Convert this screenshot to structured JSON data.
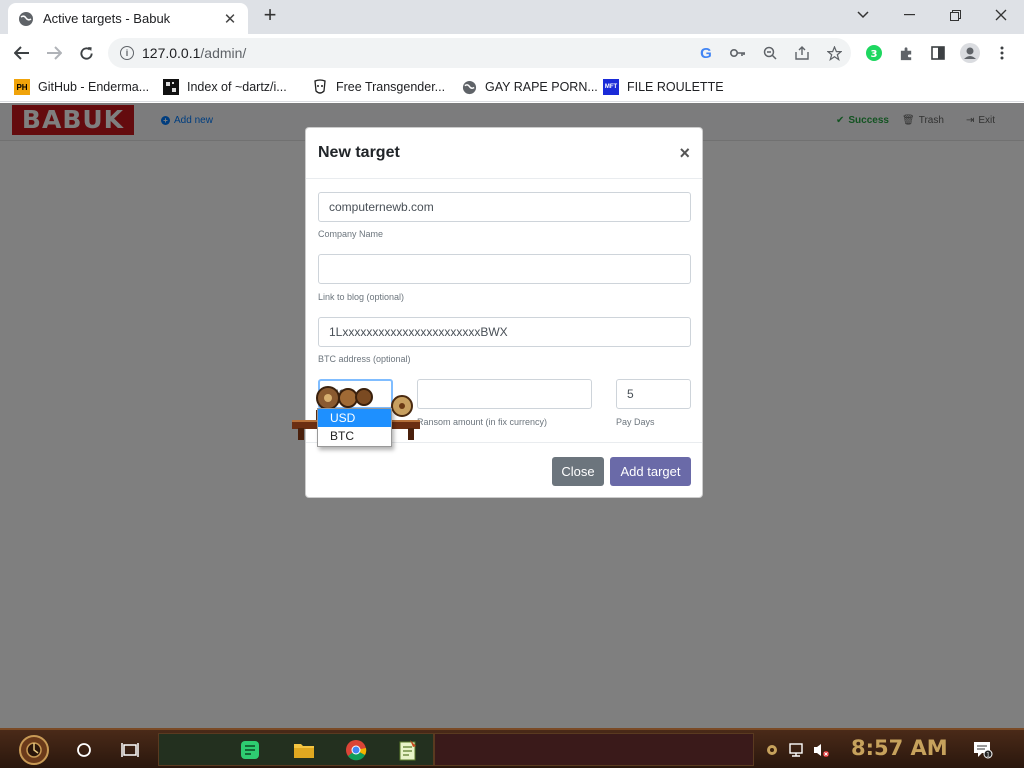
{
  "browser": {
    "tab_title": "Active targets - Babuk",
    "address_host": "127.0.0.1",
    "address_path": "/admin/",
    "bookmarks": [
      {
        "icon": "ph-icon",
        "label": "GitHub - Enderma..."
      },
      {
        "icon": "grid-icon",
        "label": "Index of ~dartz/i..."
      },
      {
        "icon": "face-icon",
        "label": "Free Transgender..."
      },
      {
        "icon": "globe-icon",
        "label": "GAY RAPE PORN..."
      },
      {
        "icon": "mft-icon",
        "label": "FILE ROULETTE"
      }
    ]
  },
  "app": {
    "logo": "BABUK",
    "add_new": "Add new",
    "success": "Success",
    "trash": "Trash",
    "exit": "Exit"
  },
  "modal": {
    "title": "New target",
    "close_x": "×",
    "company_value": "computernewb.com",
    "company_label": "Company Name",
    "blog_value": "",
    "blog_label": "Link to blog (optional)",
    "btc_value": "1LxxxxxxxxxxxxxxxxxxxxxxxBWX",
    "btc_label": "BTC address (optional)",
    "ransom_value": "",
    "ransom_label": "Ransom amount (in fix currency)",
    "paydays_value": "5",
    "paydays_label": "Pay Days",
    "currency_options": [
      "USD",
      "BTC"
    ],
    "currency_selected": "USD",
    "close_button": "Close",
    "add_button": "Add target"
  },
  "colors": {
    "logo_red": "#c8161d",
    "close_btn": "#6c757d",
    "add_btn": "#6a6aa8",
    "link_blue": "#007bff",
    "success_green": "#28a745"
  },
  "taskbar": {
    "time": "8:57 AM"
  }
}
